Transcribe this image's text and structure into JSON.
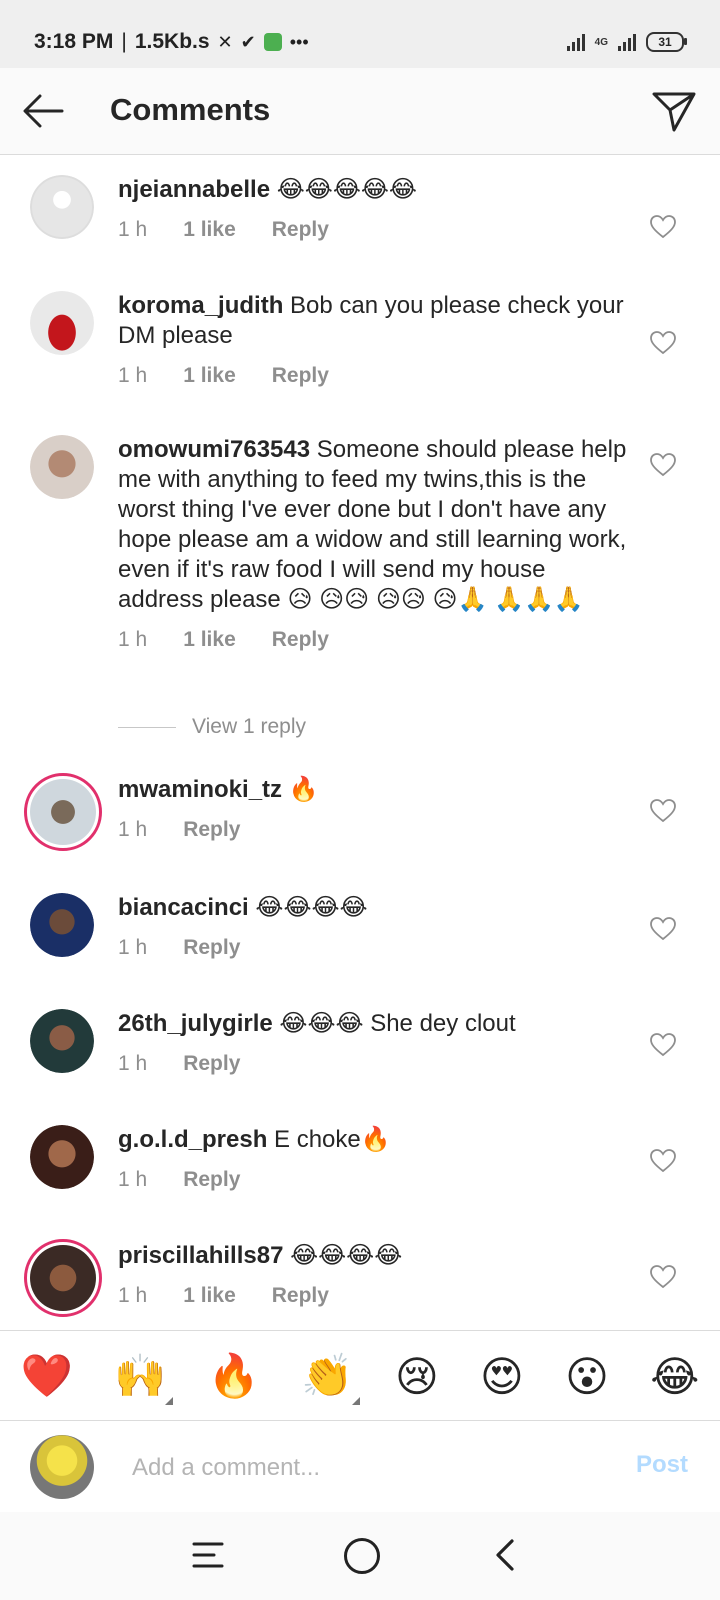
{
  "status_bar": {
    "time": "3:18 PM",
    "speed": "1.5Kb.s",
    "network": "4G",
    "battery": "31"
  },
  "header": {
    "title": "Comments"
  },
  "comments": [
    {
      "username": "njeiannabelle",
      "text": "😂😂😂😂😂",
      "time": "1 h",
      "likes": "1 like",
      "reply": "Reply"
    },
    {
      "username": "koroma_judith",
      "text": "Bob can you please check your DM please",
      "time": "1 h",
      "likes": "1 like",
      "reply": "Reply"
    },
    {
      "username": "omowumi763543",
      "text": "Someone should please help me with anything to feed my twins,this is the worst thing I've ever done but I don't have any hope please am a widow and still learning work, even if it's raw food I will send my house address please 😥 😥😥 😥😥 😥🙏 🙏🙏🙏",
      "time": "1 h",
      "likes": "1 like",
      "reply": "Reply"
    },
    {
      "username": "mwaminoki_tz",
      "text": "🔥",
      "time": "1 h",
      "reply": "Reply"
    },
    {
      "username": "biancacinci",
      "text": "😂😂😂😂",
      "time": "1 h",
      "reply": "Reply"
    },
    {
      "username": "26th_julygirle",
      "text": "😂😂😂 She dey clout",
      "time": "1 h",
      "reply": "Reply"
    },
    {
      "username": "g.o.l.d_presh",
      "text": "E choke🔥",
      "time": "1 h",
      "reply": "Reply"
    },
    {
      "username": "priscillahills87",
      "text": "😂😂😂😂",
      "time": "1 h",
      "likes": "1 like",
      "reply": "Reply"
    }
  ],
  "view_replies": "View 1 reply",
  "emoji_bar": [
    "❤️",
    "🙌",
    "🔥",
    "👏",
    "😢",
    "😍",
    "😮",
    "😂"
  ],
  "composer": {
    "placeholder": "Add a comment...",
    "post_label": "Post"
  },
  "colors": {
    "accent_post": "#b3dbff",
    "meta_gray": "#8e8e8e",
    "story_ring": "#e1306c"
  }
}
